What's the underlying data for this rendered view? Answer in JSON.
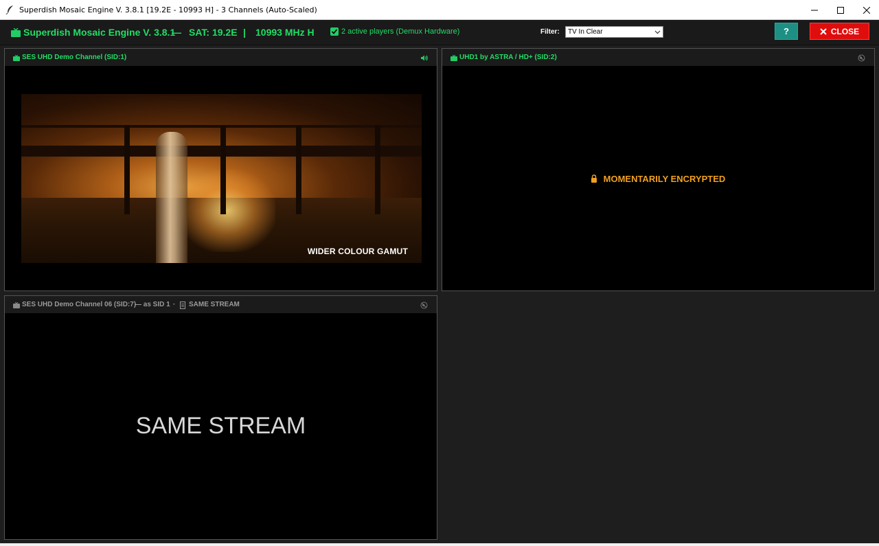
{
  "window": {
    "title": "Superdish Mosaic Engine V. 3.8.1 [19.2E - 10993 H] - 3 Channels (Auto-Scaled)",
    "icon": "feather-icon"
  },
  "header": {
    "app_name": "Superdish Mosaic Engine V. 3.8.1",
    "separator": "—",
    "sat": "SAT: 19.2E",
    "separator2": "|",
    "frequency": "10993 MHz H",
    "players": "2 active players (Demux Hardware)",
    "filter_label": "Filter:",
    "filter_value": "TV In Clear",
    "help_label": "?",
    "close_label": "CLOSE"
  },
  "tiles": [
    {
      "title": "SES UHD Demo Channel (SID:1)",
      "title_color": "#22dd66",
      "status": "audio-playing",
      "video_caption": "WIDER COLOUR GAMUT"
    },
    {
      "title": "UHD1 by ASTRA / HD+ (SID:2)",
      "title_color": "#22dd66",
      "status": "muted",
      "message": "MOMENTARILY ENCRYPTED"
    },
    {
      "title": "SES UHD Demo Channel 06 (SID:7)",
      "title_suffix": "— as SID 1",
      "dot": "·",
      "badge": "SAME STREAM",
      "title_color": "#9a9a9a",
      "status": "muted",
      "message": "SAME STREAM"
    }
  ],
  "colors": {
    "accent": "#22dd66",
    "warning": "#f0a020",
    "close": "#e00d0d",
    "help": "#1d8f83"
  }
}
